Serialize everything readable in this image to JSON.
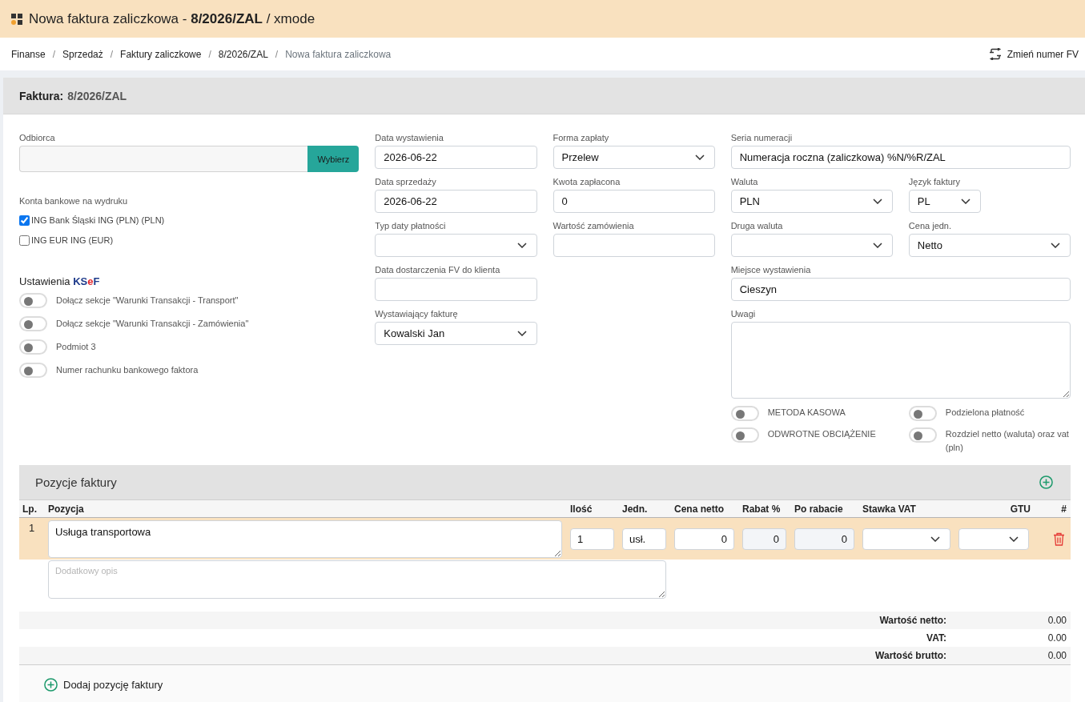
{
  "header": {
    "title": "Nowa faktura zaliczkowa - **8/2026/ZAL** / xmode"
  },
  "breadcrumb": {
    "separator": "/",
    "items": [
      {
        "label": "Finanse",
        "current": false
      },
      {
        "label": "Sprzedaż",
        "current": false
      },
      {
        "label": "Faktury zaliczkowe",
        "current": false
      },
      {
        "label": "8/2026/ZAL",
        "current": false
      },
      {
        "label": "Nowa faktura zaliczkowa",
        "current": true
      }
    ],
    "action": "Zmień numer FV"
  },
  "invoice": {
    "title_label": "Faktura:",
    "title_number": "8/2026/ZAL",
    "recipient": {
      "label": "Odbiorca",
      "button": "Wybierz"
    },
    "bank_accounts": {
      "label": "Konta bankowe na wydruku",
      "items": [
        {
          "label": "ING Bank Śląski ING (PLN) (PLN)",
          "checked": true
        },
        {
          "label": "ING EUR ING (EUR)",
          "checked": false
        }
      ]
    },
    "ksef": {
      "title": "Ustawienia",
      "logo": [
        {
          "text": "KS",
          "color": "#1d3a8a"
        },
        {
          "text": "e",
          "color": "#e3262d"
        },
        {
          "text": "F",
          "color": "#1d3a8a"
        }
      ],
      "toggles": [
        {
          "label": "Dołącz sekcje \"Warunki Transakcji - Transport\"",
          "on": false
        },
        {
          "label": "Dołącz sekcje \"Warunki Transakcji - Zamówienia\"",
          "on": false
        },
        {
          "label": "Podmiot 3",
          "on": false
        },
        {
          "label": "Numer rachunku bankowego faktora",
          "on": false
        }
      ]
    },
    "dates_column": [
      {
        "kind": "input",
        "label": "Data wystawienia",
        "value": "2026-06-22"
      },
      {
        "kind": "input",
        "label": "Data sprzedaży",
        "value": "2026-06-22"
      },
      {
        "kind": "select",
        "label": "Typ daty płatności"
      },
      {
        "kind": "input",
        "label": "Data dostarczenia FV do klienta"
      },
      {
        "kind": "select",
        "label": "Wystawiający fakturę",
        "value": "Kowalski Jan"
      }
    ],
    "payment_column": [
      {
        "kind": "select",
        "label": "Forma zapłaty",
        "value": "Przelew"
      },
      {
        "kind": "input",
        "label": "Kwota zapłacona",
        "value": "0"
      },
      {
        "kind": "input",
        "label": "Wartość zamówienia"
      }
    ],
    "settings_rows": [
      {
        "fields": [
          {
            "kind": "input",
            "label": "Seria numeracji",
            "value": "Numeracja roczna (zaliczkowa) %N/%R/ZAL"
          }
        ]
      },
      {
        "fields": [
          {
            "kind": "select",
            "label": "Waluta",
            "value": "PLN"
          },
          {
            "kind": "short-select",
            "label": "Język faktury",
            "value": "PL"
          }
        ]
      },
      {
        "fields": [
          {
            "kind": "select",
            "label": "Druga waluta"
          },
          {
            "kind": "select",
            "label": "Cena jedn.",
            "value": "Netto"
          }
        ]
      },
      {
        "fields": [
          {
            "kind": "input",
            "label": "Miejsce wystawienia",
            "value": "Cieszyn"
          }
        ]
      },
      {
        "fields": [
          {
            "kind": "textarea",
            "label": "Uwagi"
          }
        ]
      }
    ],
    "flags": [
      {
        "label": "METODA KASOWA",
        "on": false
      },
      {
        "label": "Podzielona płatność",
        "on": false
      },
      {
        "label": "ODWROTNE OBCIĄŻENIE",
        "on": false
      },
      {
        "label": "Rozdziel netto (waluta) oraz vat (pln)",
        "on": false
      }
    ]
  },
  "items": {
    "title": "Pozycje faktury",
    "columns": [
      "Lp.",
      "Pozycja",
      "Ilość",
      "Jedn.",
      "Cena netto",
      "Rabat %",
      "Po rabacie",
      "Stawka VAT",
      "GTU",
      "#"
    ],
    "rows": [
      {
        "selected": true,
        "cells": [
          {
            "kind": "number",
            "value": "1"
          },
          {
            "kind": "name",
            "value": "Usługa transportowa"
          },
          {
            "kind": "text",
            "value": "1"
          },
          {
            "kind": "text",
            "value": "usł."
          },
          {
            "kind": "amount",
            "value": "0"
          },
          {
            "kind": "readonly-amount",
            "value": "0"
          },
          {
            "kind": "readonly-amount",
            "value": "0"
          },
          {
            "kind": "select"
          },
          {
            "kind": "select"
          },
          {
            "kind": "delete"
          }
        ],
        "description_placeholder": "Dodatkowy opis"
      }
    ],
    "totals": [
      {
        "label": "Wartość netto:",
        "value": "0.00"
      },
      {
        "label": "VAT:",
        "value": "0.00"
      },
      {
        "label": "Wartość brutto:",
        "value": "0.00"
      }
    ],
    "add_button": "Dodaj pozycję faktury"
  }
}
